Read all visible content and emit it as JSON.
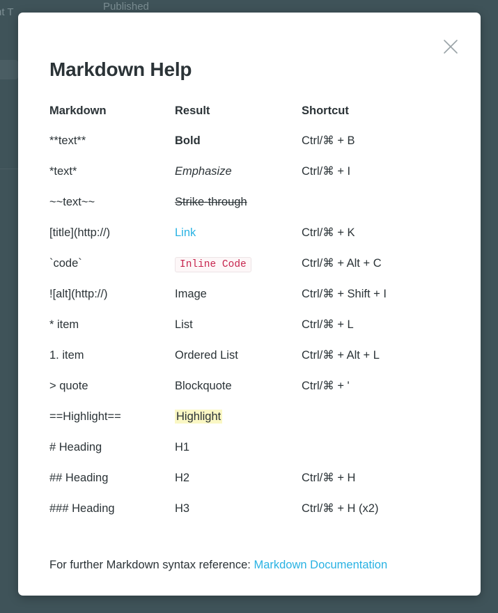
{
  "backdrop": {
    "document_title_partial": "nt T",
    "published_label": "Published",
    "overlay_color": "#3f5359"
  },
  "modal": {
    "title": "Markdown Help",
    "close_icon_label": "×",
    "accent_link_color": "#29b2e3",
    "code_text_color": "#c7254e",
    "highlight_color": "#faf7c4"
  },
  "table": {
    "headers": [
      "Markdown",
      "Result",
      "Shortcut"
    ],
    "rows": [
      {
        "markdown": "**text**",
        "result": "Bold",
        "style": "bold",
        "shortcut": "Ctrl/⌘ + B"
      },
      {
        "markdown": "*text*",
        "result": "Emphasize",
        "style": "italic",
        "shortcut": "Ctrl/⌘ + I"
      },
      {
        "markdown": "~~text~~",
        "result": "Strike-through",
        "style": "strike",
        "shortcut": ""
      },
      {
        "markdown": "[title](http://)",
        "result": "Link",
        "style": "link",
        "shortcut": "Ctrl/⌘ + K"
      },
      {
        "markdown": "`code`",
        "result": "Inline Code",
        "style": "code",
        "shortcut": "Ctrl/⌘ + Alt + C"
      },
      {
        "markdown": "![alt](http://)",
        "result": "Image",
        "style": "plain",
        "shortcut": "Ctrl/⌘ + Shift + I"
      },
      {
        "markdown": "* item",
        "result": "List",
        "style": "plain",
        "shortcut": "Ctrl/⌘ + L"
      },
      {
        "markdown": "1. item",
        "result": "Ordered List",
        "style": "plain",
        "shortcut": "Ctrl/⌘ + Alt + L"
      },
      {
        "markdown": "> quote",
        "result": "Blockquote",
        "style": "plain",
        "shortcut": "Ctrl/⌘ + '"
      },
      {
        "markdown": "==Highlight==",
        "result": "Highlight",
        "style": "highlight",
        "shortcut": ""
      },
      {
        "markdown": "# Heading",
        "result": "H1",
        "style": "plain",
        "shortcut": ""
      },
      {
        "markdown": "## Heading",
        "result": "H2",
        "style": "plain",
        "shortcut": "Ctrl/⌘ + H"
      },
      {
        "markdown": "### Heading",
        "result": "H3",
        "style": "plain",
        "shortcut": "Ctrl/⌘ + H (x2)"
      }
    ]
  },
  "footer": {
    "text": "For further Markdown syntax reference:",
    "link_label": "Markdown Documentation"
  }
}
